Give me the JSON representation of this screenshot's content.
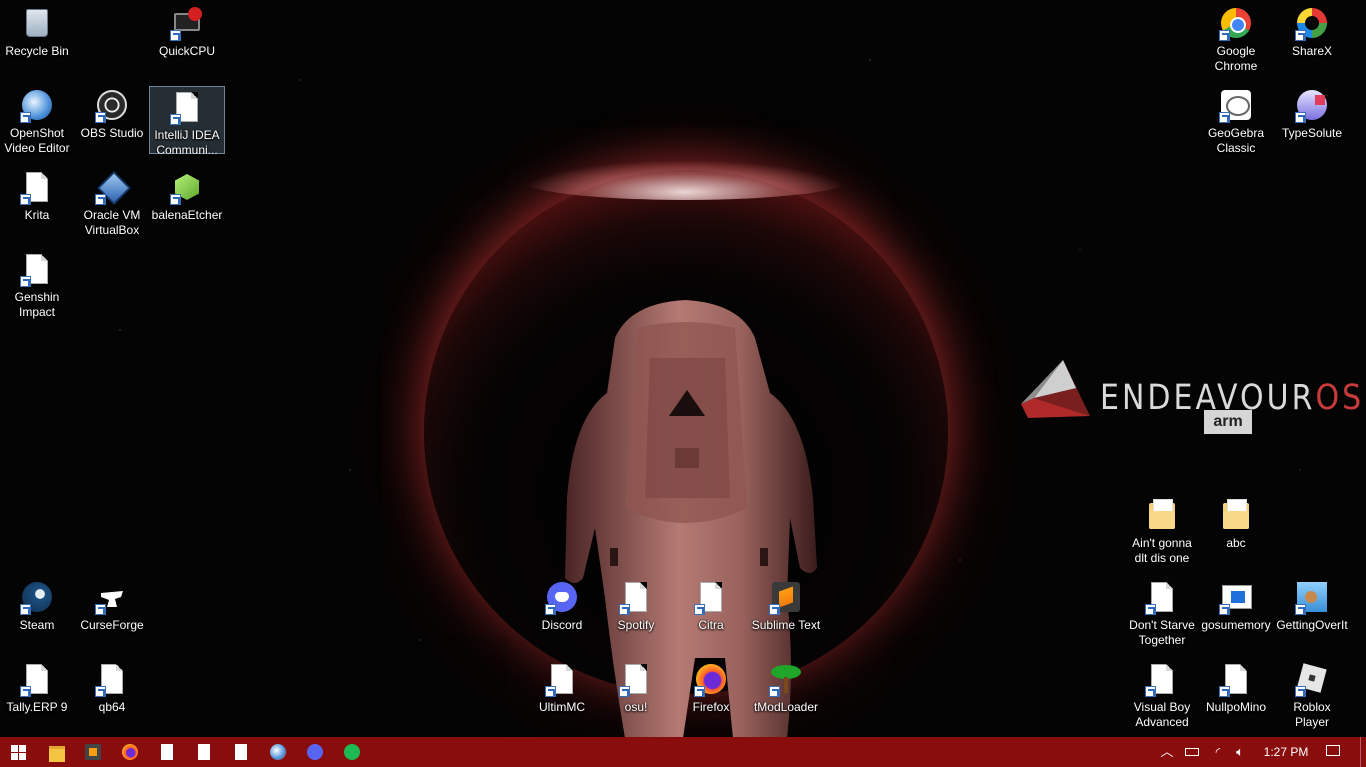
{
  "desktop": {
    "wallpaper": {
      "brand": "ENDEAVOUR",
      "brand_os": "OS",
      "edition": "arm",
      "accent": "#c93a3a"
    },
    "icons": [
      {
        "id": "recycle-bin",
        "label": "Recycle Bin",
        "icon": "recycle-bin-icon"
      },
      {
        "id": "quickcpu",
        "label": "QuickCPU",
        "icon": "quickcpu-icon"
      },
      {
        "id": "openshot",
        "label": "OpenShot Video Editor",
        "icon": "openshot-icon"
      },
      {
        "id": "obs",
        "label": "OBS Studio",
        "icon": "obs-icon"
      },
      {
        "id": "intellij",
        "label": "IntelliJ IDEA Communi...",
        "icon": "document-icon",
        "selected": true
      },
      {
        "id": "krita",
        "label": "Krita",
        "icon": "document-icon"
      },
      {
        "id": "virtualbox",
        "label": "Oracle VM VirtualBox",
        "icon": "virtualbox-icon"
      },
      {
        "id": "balenaetcher",
        "label": "balenaEtcher",
        "icon": "balenaetcher-icon"
      },
      {
        "id": "genshin",
        "label": "Genshin Impact",
        "icon": "document-icon"
      },
      {
        "id": "steam",
        "label": "Steam",
        "icon": "steam-icon"
      },
      {
        "id": "curseforge",
        "label": "CurseForge",
        "icon": "curseforge-icon"
      },
      {
        "id": "tally",
        "label": "Tally.ERP 9",
        "icon": "document-icon"
      },
      {
        "id": "qb64",
        "label": "qb64",
        "icon": "document-icon"
      },
      {
        "id": "discord",
        "label": "Discord",
        "icon": "discord-icon"
      },
      {
        "id": "spotify",
        "label": "Spotify",
        "icon": "document-icon"
      },
      {
        "id": "citra",
        "label": "Citra",
        "icon": "document-icon"
      },
      {
        "id": "sublime",
        "label": "Sublime Text",
        "icon": "sublime-icon"
      },
      {
        "id": "ultimmc",
        "label": "UltimMC",
        "icon": "document-icon"
      },
      {
        "id": "osu",
        "label": "osu!",
        "icon": "document-icon"
      },
      {
        "id": "firefox",
        "label": "Firefox",
        "icon": "firefox-icon"
      },
      {
        "id": "tmodloader",
        "label": "tModLoader",
        "icon": "tmodloader-icon"
      },
      {
        "id": "chrome",
        "label": "Google Chrome",
        "icon": "chrome-icon"
      },
      {
        "id": "sharex",
        "label": "ShareX",
        "icon": "sharex-icon"
      },
      {
        "id": "geogebra",
        "label": "GeoGebra Classic",
        "icon": "geogebra-icon"
      },
      {
        "id": "typesolute",
        "label": "TypeSolute",
        "icon": "typesolute-icon"
      },
      {
        "id": "aint-gonna",
        "label": "Ain't gonna dlt dis one",
        "icon": "folder-icon"
      },
      {
        "id": "abc",
        "label": "abc",
        "icon": "folder-icon"
      },
      {
        "id": "dont-starve",
        "label": "Don't Starve Together",
        "icon": "document-icon"
      },
      {
        "id": "gosumemory",
        "label": "gosumemory",
        "icon": "gosumemory-icon"
      },
      {
        "id": "gettingoverit",
        "label": "GettingOverIt",
        "icon": "gettingoverit-icon"
      },
      {
        "id": "visual-boy",
        "label": "Visual Boy Advanced",
        "icon": "document-icon"
      },
      {
        "id": "nullpomino",
        "label": "NullpoMino",
        "icon": "document-icon"
      },
      {
        "id": "roblox",
        "label": "Roblox Player",
        "icon": "roblox-icon"
      }
    ]
  },
  "taskbar": {
    "color": "#8a0d0d",
    "pinned": [
      {
        "id": "start",
        "icon": "windows-start-icon"
      },
      {
        "id": "explorer",
        "icon": "file-explorer-icon"
      },
      {
        "id": "sublime",
        "icon": "sublime-icon"
      },
      {
        "id": "firefox",
        "icon": "firefox-icon"
      },
      {
        "id": "doc1",
        "icon": "document-icon"
      },
      {
        "id": "doc2",
        "icon": "document-icon"
      },
      {
        "id": "doc3",
        "icon": "document-icon"
      },
      {
        "id": "openshot",
        "icon": "openshot-icon"
      },
      {
        "id": "discord",
        "icon": "discord-icon"
      },
      {
        "id": "spotify",
        "icon": "spotify-icon"
      }
    ],
    "tray": {
      "clock": "1:27 PM"
    }
  }
}
